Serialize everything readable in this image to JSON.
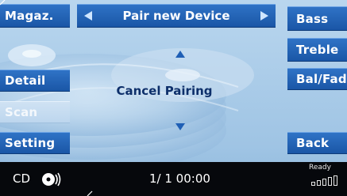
{
  "left_buttons": [
    {
      "label": "Magaz.",
      "enabled": true
    },
    {
      "label": "Detail",
      "enabled": true
    },
    {
      "label": "Scan",
      "enabled": false
    },
    {
      "label": "Setting",
      "enabled": true
    }
  ],
  "right_buttons": [
    {
      "label": "Bass"
    },
    {
      "label": "Treble"
    },
    {
      "label": "Bal/Fad"
    },
    {
      "label": "Back"
    }
  ],
  "title_bar": {
    "label": "Pair new Device"
  },
  "center": {
    "label": "Cancel Pairing"
  },
  "status_bar": {
    "source": "CD",
    "source_icon": "cd-disc-icon",
    "track_time": "1/  1 00:00",
    "ready_label": "Ready",
    "signal_icon": "signal-strength-icon"
  },
  "colors": {
    "button_blue": "#1f5fb5",
    "background": "#a9cbe8",
    "status_bar": "#06080c",
    "center_text": "#0d2f6a"
  }
}
